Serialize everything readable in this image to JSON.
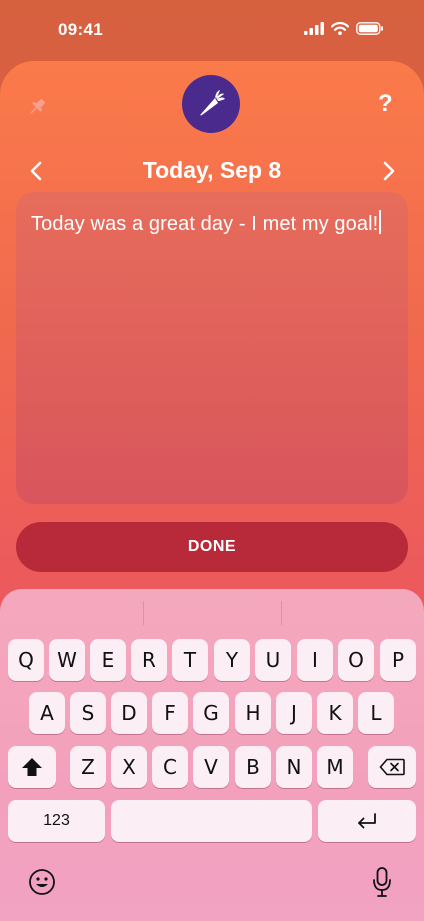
{
  "status": {
    "time": "09:41"
  },
  "header": {
    "date": "Today, Sep 8",
    "help": "?"
  },
  "editor": {
    "text": "Today was a great day - I met my goal!"
  },
  "done_label": "DONE",
  "keyboard": {
    "row1": [
      "Q",
      "W",
      "E",
      "R",
      "T",
      "Y",
      "U",
      "I",
      "O",
      "P"
    ],
    "row2": [
      "A",
      "S",
      "D",
      "F",
      "G",
      "H",
      "J",
      "K",
      "L"
    ],
    "row3": [
      "Z",
      "X",
      "C",
      "V",
      "B",
      "N",
      "M"
    ],
    "numbers_label": "123"
  },
  "colors": {
    "logo_bg": "#4b2a8e",
    "done_bg": "#b82a3a"
  },
  "icons": {
    "pin": "pin-icon",
    "logo": "carrot-icon",
    "back": "chevron-left-icon",
    "forward": "chevron-right-icon",
    "shift": "shift-icon",
    "delete": "backspace-icon",
    "return": "return-icon",
    "emoji": "emoji-icon",
    "mic": "microphone-icon"
  }
}
